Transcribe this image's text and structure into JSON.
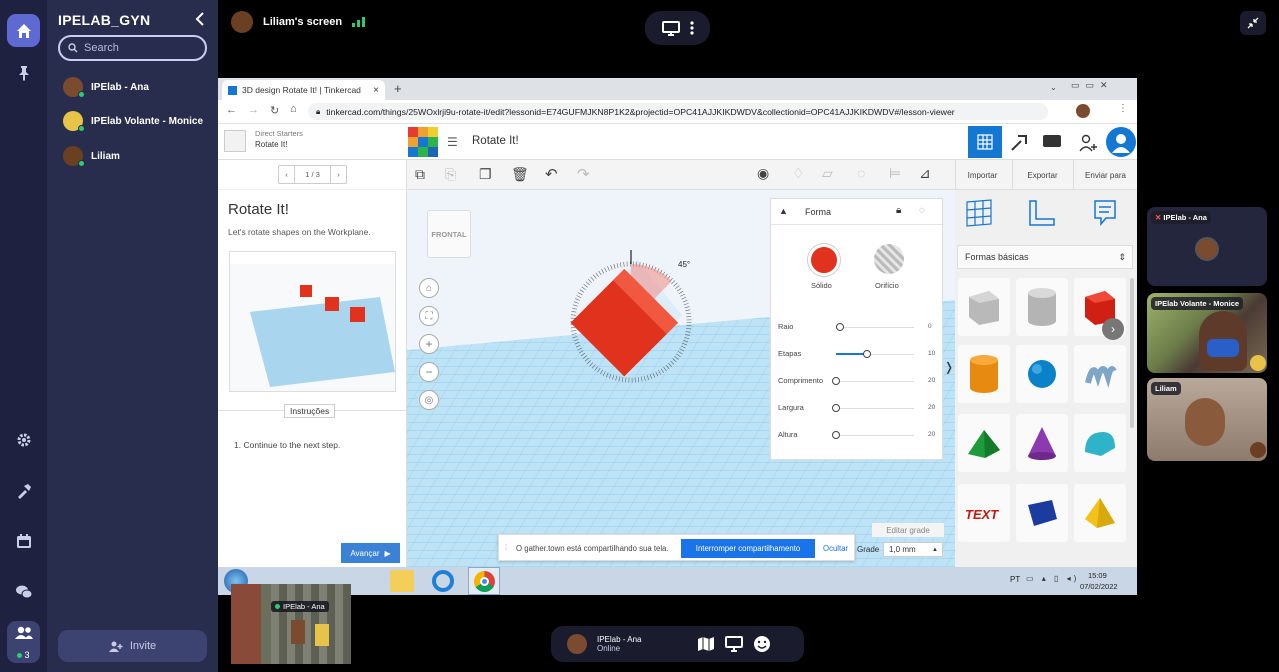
{
  "sidebar": {
    "title": "IPELAB_GYN",
    "search_placeholder": "Search",
    "users": [
      {
        "name": "IPElab - Ana"
      },
      {
        "name": "IPElab Volante - Monice"
      },
      {
        "name": "Liliam"
      }
    ],
    "invite_label": "Invite",
    "people_count": "3"
  },
  "share": {
    "title": "Liliam's screen"
  },
  "browser": {
    "tab_title": "3D design Rotate It! | Tinkercad",
    "url": "tinkercad.com/things/25WOxlrji9u-rotate-it/edit?lessonid=E74GUFMJKN8P1K2&projectid=OPC41AJJKIKDWDV&collectionid=OPC41AJJKIKDWDV#/lesson-viewer"
  },
  "tinkercad": {
    "breadcrumb_parent": "Direct Starters",
    "breadcrumb_current": "Rotate It!",
    "logo_letters": [
      "TIN",
      "KER",
      "CAD"
    ],
    "design_title": "Rotate It!",
    "page_indicator": "1 / 3",
    "lesson_title": "Rotate It!",
    "lesson_subtitle": "Let's rotate shapes on the Workplane.",
    "instructions_label": "Instruções",
    "step_text": "1. Continue to the next step.",
    "next_button": "Avançar",
    "import_label": "Importar",
    "export_label": "Exportar",
    "send_label": "Enviar para",
    "view_cube_label": "FRONTAL",
    "angle_label": "45°",
    "shape_panel": {
      "title": "Forma",
      "solid_label": "Sólido",
      "hole_label": "Orifício",
      "params": [
        {
          "label": "Raio",
          "value": "0",
          "fraction": 0.05
        },
        {
          "label": "Etapas",
          "value": "10",
          "fraction": 0.4
        },
        {
          "label": "Comprimento",
          "value": "20",
          "fraction": 0.0
        },
        {
          "label": "Largura",
          "value": "20",
          "fraction": 0.0
        },
        {
          "label": "Altura",
          "value": "20",
          "fraction": 0.0
        }
      ]
    },
    "library_dropdown": "Formas básicas",
    "edit_grid": "Editar grade",
    "grid_label": "Grade",
    "grid_value": "1,0 mm"
  },
  "notification": {
    "text": "O gather.town está compartilhando sua tela.",
    "stop_button": "Interromper compartilhamento",
    "hide_button": "Ocultar"
  },
  "taskbar": {
    "lang": "PT",
    "time": "15:09",
    "date": "07/02/2022"
  },
  "minimap_label": "IPElab - Ana",
  "bottom_bar": {
    "name": "IPElab - Ana",
    "status": "Online"
  },
  "video_tiles": [
    {
      "name": "IPElab - Ana"
    },
    {
      "name": "IPElab Volante - Monice"
    },
    {
      "name": "Liliam"
    }
  ],
  "colors": {
    "accent_blue": "#5e6ad2",
    "tinkercad_blue": "#1a73e8",
    "shape_red": "#e0321c"
  }
}
